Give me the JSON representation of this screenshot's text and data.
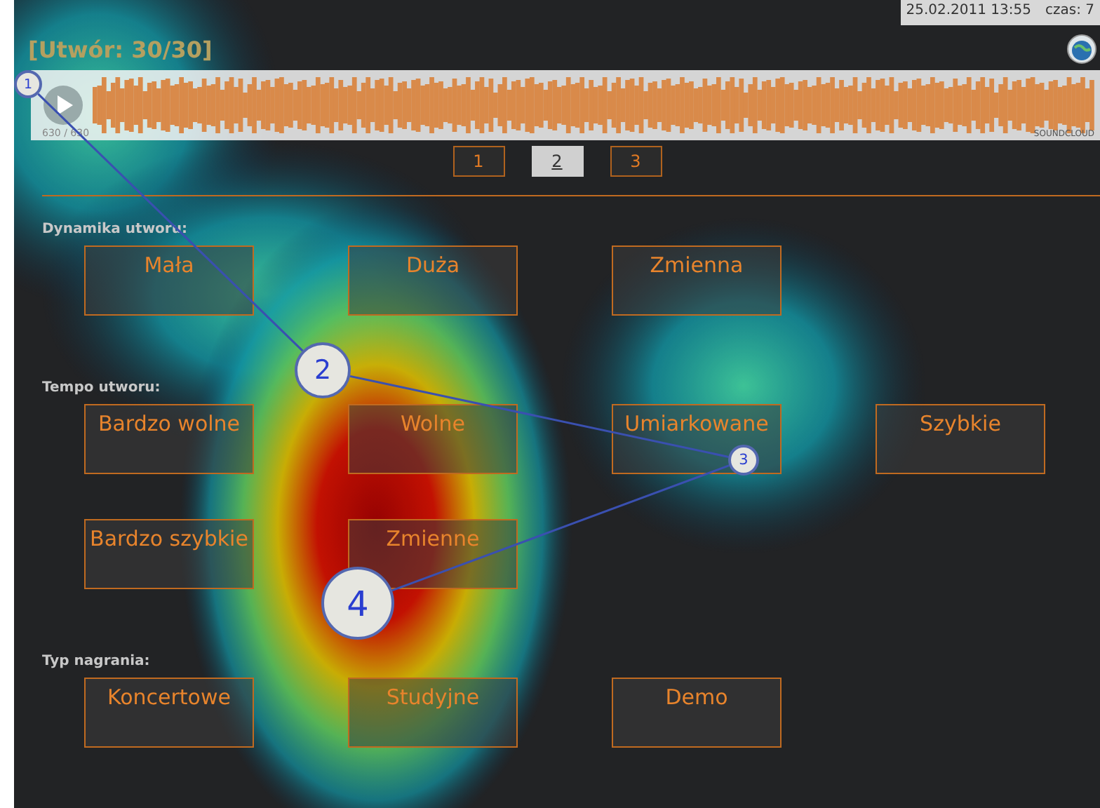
{
  "header": {
    "timestamp": "25.02.2011 13:55",
    "timer": "czas: 7"
  },
  "title": "[Utwór: 30/30]",
  "player": {
    "position": "630 / 630",
    "brand": "SOUNDCLOUD"
  },
  "pages": [
    {
      "label": "1",
      "selected": false
    },
    {
      "label": "2",
      "selected": true
    },
    {
      "label": "3",
      "selected": false
    }
  ],
  "sections": [
    {
      "title": "Dynamika utworu:",
      "options": [
        {
          "label": "Mała"
        },
        {
          "label": "Duża"
        },
        {
          "label": "Zmienna"
        }
      ]
    },
    {
      "title": "Tempo utworu:",
      "options": [
        {
          "label": "Bardzo wolne"
        },
        {
          "label": "Wolne"
        },
        {
          "label": "Umiarkowane"
        },
        {
          "label": "Szybkie"
        },
        {
          "label": "Bardzo szybkie"
        },
        {
          "label": "Zmienne"
        }
      ]
    },
    {
      "title": "Typ nagrania:",
      "options": [
        {
          "label": "Koncertowe"
        },
        {
          "label": "Studyjne"
        },
        {
          "label": "Demo"
        }
      ]
    }
  ],
  "gaze_points": [
    {
      "label": "1"
    },
    {
      "label": "2"
    },
    {
      "label": "3"
    },
    {
      "label": "4"
    }
  ]
}
